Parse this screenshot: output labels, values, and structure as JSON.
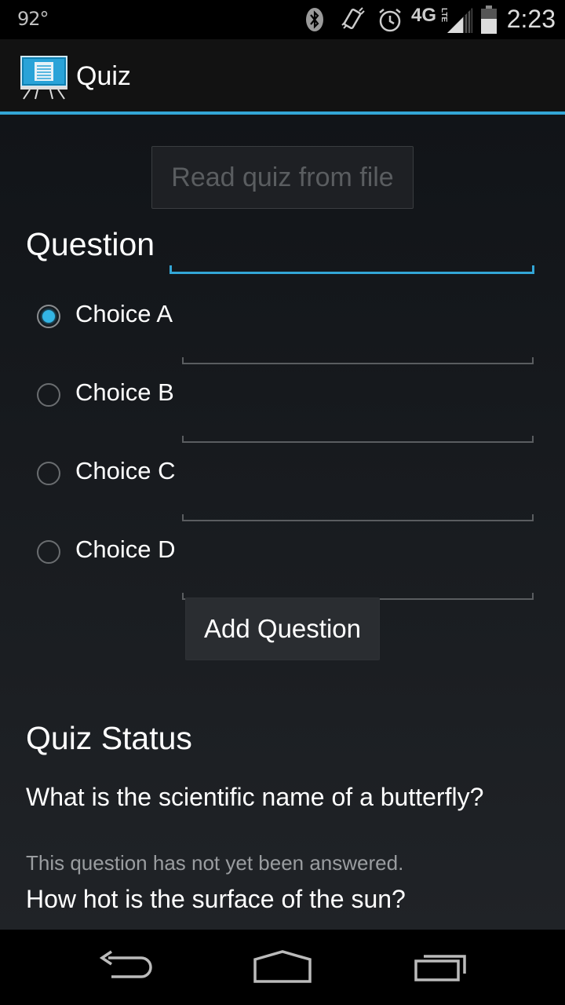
{
  "status_bar": {
    "temperature": "92°",
    "network_label": "4G",
    "lte_label": "LTE",
    "time": "2:23",
    "icons": [
      "bluetooth-icon",
      "vibrate-icon",
      "alarm-icon",
      "signal-icon",
      "battery-icon"
    ]
  },
  "action_bar": {
    "title": "Quiz",
    "icon": "presentation-board-icon",
    "accent_color": "#33a6d6"
  },
  "form": {
    "read_button_label": "Read quiz from file",
    "question_label": "Question",
    "question_value": "",
    "choices": [
      {
        "label": "Choice A",
        "checked": true,
        "value": ""
      },
      {
        "label": "Choice B",
        "checked": false,
        "value": ""
      },
      {
        "label": "Choice C",
        "checked": false,
        "value": ""
      },
      {
        "label": "Choice D",
        "checked": false,
        "value": ""
      }
    ],
    "add_button_label": "Add Question"
  },
  "quiz_status": {
    "title": "Quiz Status",
    "items": [
      {
        "question": "What is the scientific name of a butterfly?",
        "status": "This question has not yet been answered."
      },
      {
        "question": "How hot is the surface of the sun?",
        "status": ""
      }
    ]
  },
  "nav_bar": {
    "icons": [
      "back-icon",
      "home-icon",
      "recents-icon"
    ]
  }
}
